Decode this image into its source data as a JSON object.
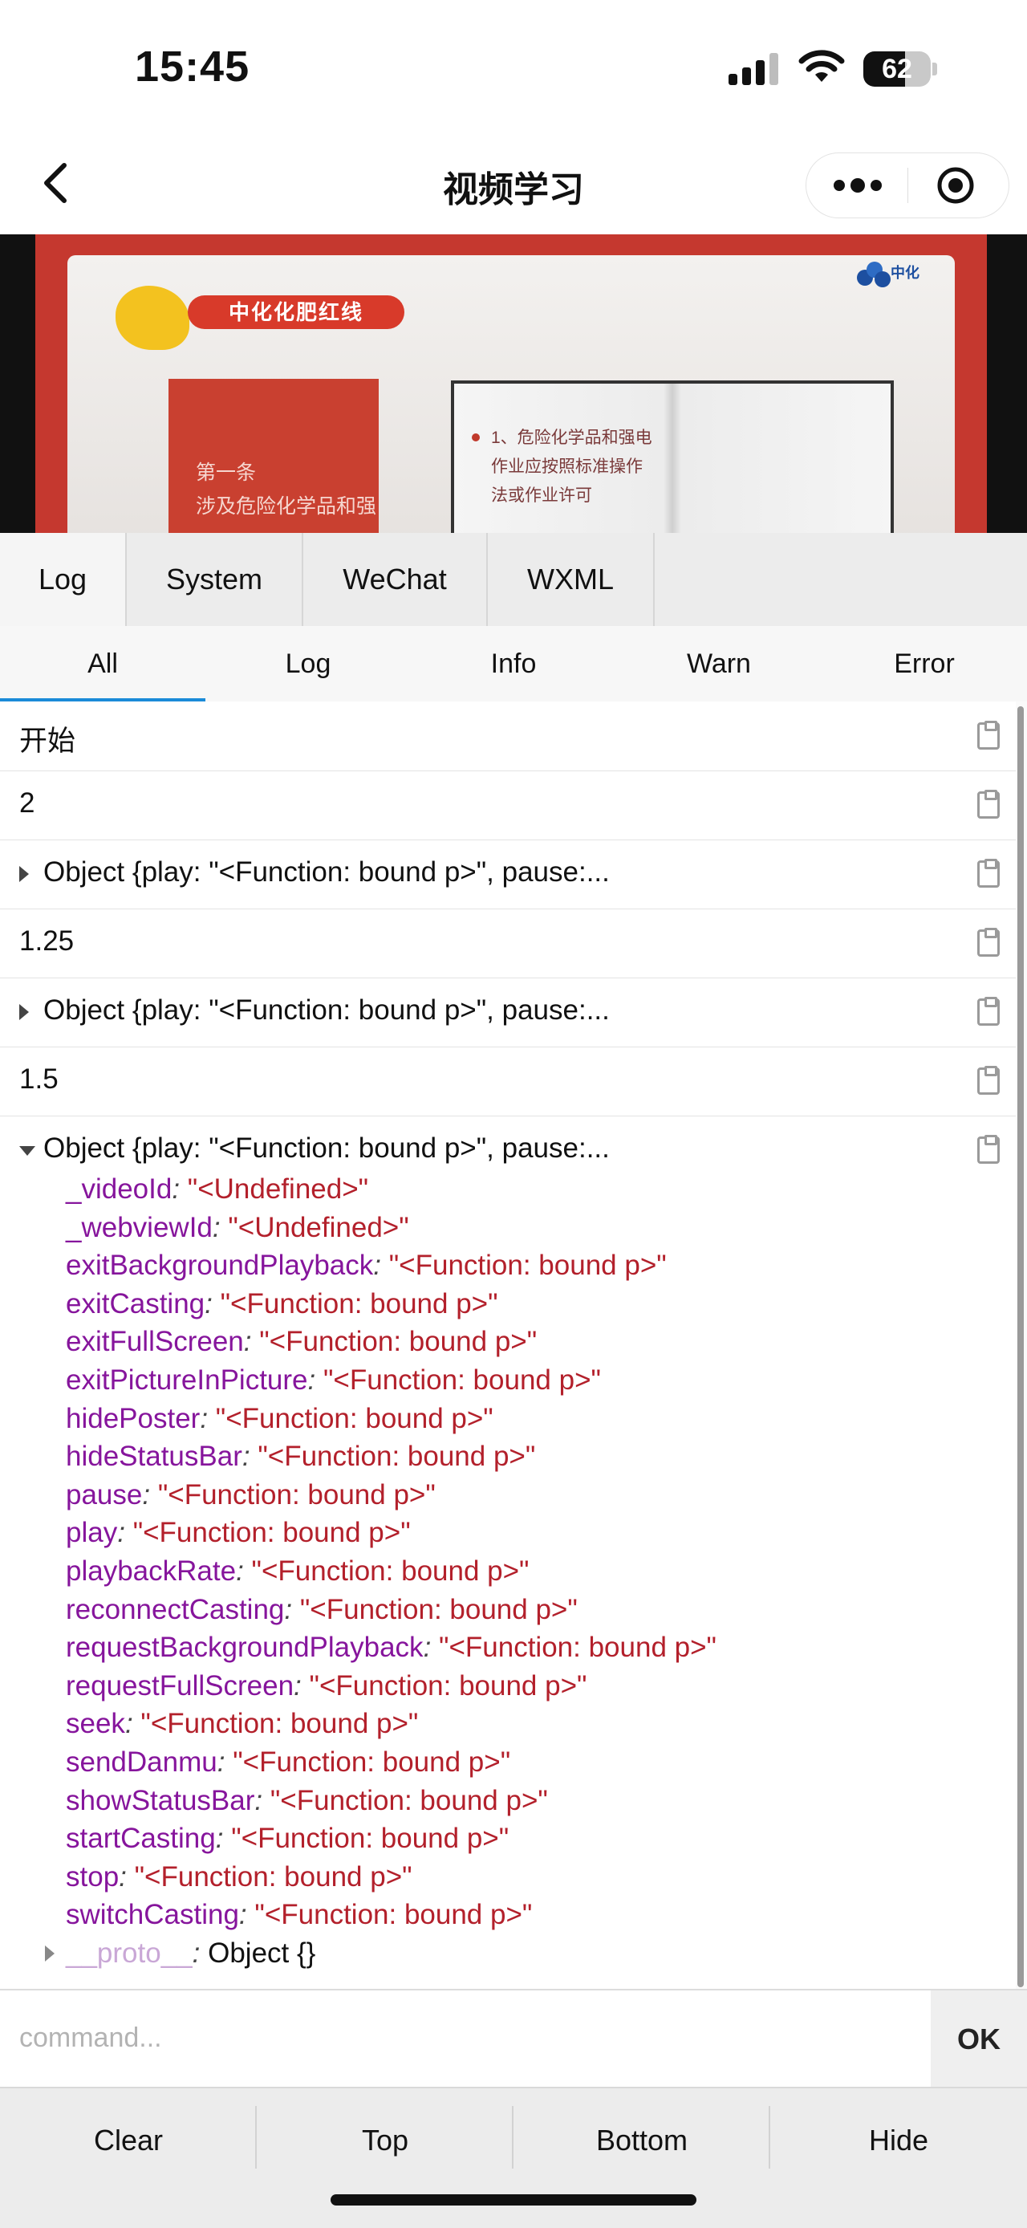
{
  "status_bar": {
    "time": "15:45",
    "battery": "62",
    "battery_level": 0.62
  },
  "nav": {
    "title": "视频学习"
  },
  "video": {
    "pill_text": "中化化肥红线",
    "book_lines": [
      "第一条",
      "涉及危险化学品和强"
    ],
    "open_book_lines": [
      "1、危险化学品和强电",
      "作业应按照标准操作",
      "法或作业许可"
    ],
    "logo_text": "中化"
  },
  "tabs": [
    {
      "label": "Log"
    },
    {
      "label": "System"
    },
    {
      "label": "WeChat"
    },
    {
      "label": "WXML"
    }
  ],
  "filters": [
    {
      "label": "All"
    },
    {
      "label": "Log"
    },
    {
      "label": "Info"
    },
    {
      "label": "Warn"
    },
    {
      "label": "Error"
    }
  ],
  "log": {
    "rows": [
      {
        "text": "开始"
      },
      {
        "text": "2"
      },
      {
        "text": "Object {play: \"<Function: bound p>\", pause:..."
      },
      {
        "text": "1.25"
      },
      {
        "text": "Object {play: \"<Function: bound p>\", pause:..."
      },
      {
        "text": "1.5"
      },
      {
        "text": "Object {play: \"<Function: bound p>\", pause:..."
      }
    ],
    "props": [
      {
        "key": "_videoId",
        "sep": ":",
        "value": "\"<Undefined>\""
      },
      {
        "key": "_webviewId",
        "sep": ":",
        "value": "\"<Undefined>\""
      },
      {
        "key": "exitBackgroundPlayback",
        "sep": ":",
        "value": "\"<Function: bound p>\""
      },
      {
        "key": "exitCasting",
        "sep": ":",
        "value": "\"<Function: bound p>\""
      },
      {
        "key": "exitFullScreen",
        "sep": ":",
        "value": "\"<Function: bound p>\""
      },
      {
        "key": "exitPictureInPicture",
        "sep": ":",
        "value": "\"<Function: bound p>\""
      },
      {
        "key": "hidePoster",
        "sep": ":",
        "value": "\"<Function: bound p>\""
      },
      {
        "key": "hideStatusBar",
        "sep": ":",
        "value": "\"<Function: bound p>\""
      },
      {
        "key": "pause",
        "sep": ":",
        "value": "\"<Function: bound p>\""
      },
      {
        "key": "play",
        "sep": ":",
        "value": "\"<Function: bound p>\""
      },
      {
        "key": "playbackRate",
        "sep": ":",
        "value": "\"<Function: bound p>\""
      },
      {
        "key": "reconnectCasting",
        "sep": ":",
        "value": "\"<Function: bound p>\""
      },
      {
        "key": "requestBackgroundPlayback",
        "sep": ":",
        "value": "\"<Function: bound p>\""
      },
      {
        "key": "requestFullScreen",
        "sep": ":",
        "value": "\"<Function: bound p>\""
      },
      {
        "key": "seek",
        "sep": ":",
        "value": "\"<Function: bound p>\""
      },
      {
        "key": "sendDanmu",
        "sep": ":",
        "value": "\"<Function: bound p>\""
      },
      {
        "key": "showStatusBar",
        "sep": ":",
        "value": "\"<Function: bound p>\""
      },
      {
        "key": "startCasting",
        "sep": ":",
        "value": "\"<Function: bound p>\""
      },
      {
        "key": "stop",
        "sep": ":",
        "value": "\"<Function: bound p>\""
      },
      {
        "key": "switchCasting",
        "sep": ":",
        "value": "\"<Function: bound p>\""
      }
    ],
    "proto": {
      "key": "__proto__",
      "sep": ":",
      "value": "Object {}"
    }
  },
  "command": {
    "placeholder": "command...",
    "ok_label": "OK"
  },
  "bottom": {
    "clear": "Clear",
    "top": "Top",
    "bottom": "Bottom",
    "hide": "Hide"
  },
  "colors": {
    "accent": "#1a8bd8",
    "key": "#86159c",
    "value": "#b3202b"
  }
}
